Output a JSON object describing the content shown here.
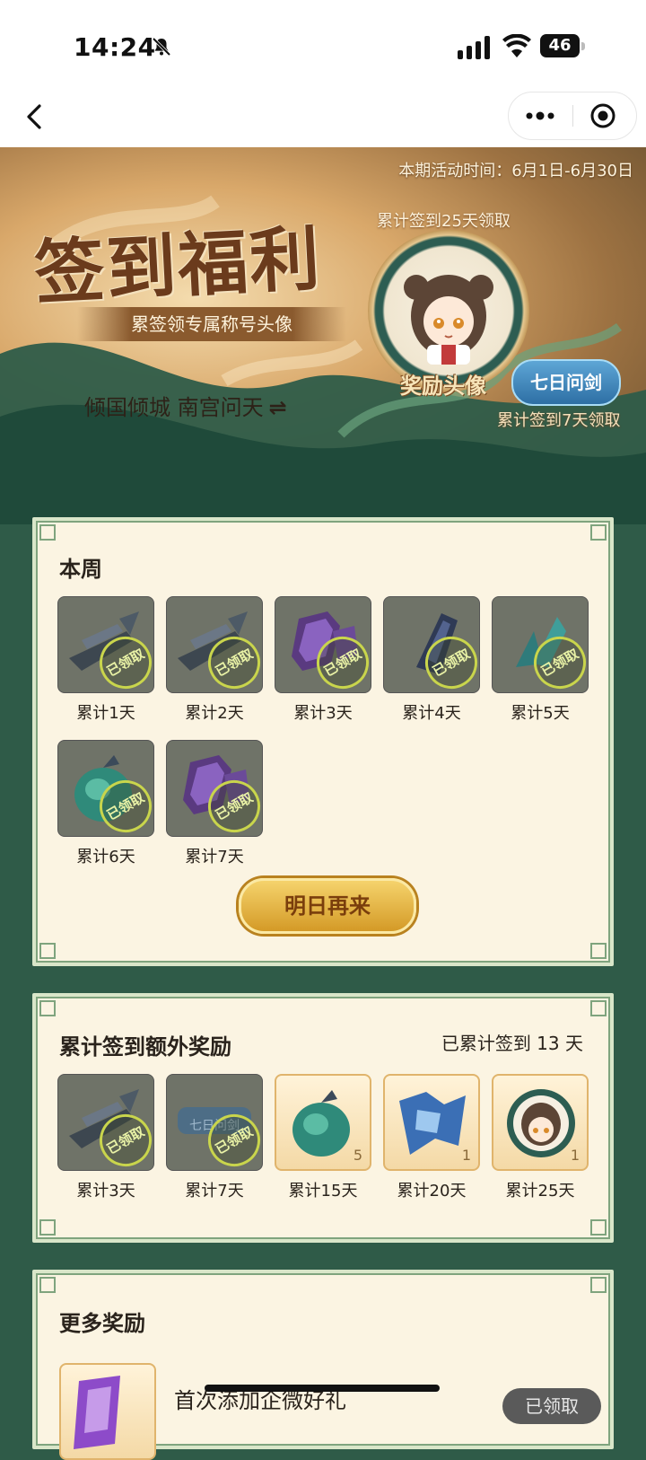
{
  "status": {
    "time": "14:24",
    "battery": "46"
  },
  "hero": {
    "period": "本期活动时间：6月1日-6月30日",
    "title": "签到福利",
    "subtitle": "累签领专属称号头像",
    "player": "倾国倾城 南宫问天",
    "swap_icon": "⇌",
    "avatar_requirement": "累计签到25天领取",
    "avatar_label": "奖励头像",
    "badge": "七日问剑",
    "badge_requirement": "累计签到7天领取"
  },
  "week": {
    "title": "本周",
    "claimed_text": "已领取",
    "items": [
      {
        "label": "累计1天",
        "icon": "broken-sword-icon"
      },
      {
        "label": "累计2天",
        "icon": "broken-sword-icon"
      },
      {
        "label": "累计3天",
        "icon": "purple-token-icon"
      },
      {
        "label": "累计4天",
        "icon": "blue-crystal-icon"
      },
      {
        "label": "累计5天",
        "icon": "teal-shard-icon"
      },
      {
        "label": "累计6天",
        "icon": "green-pouch-icon"
      },
      {
        "label": "累计7天",
        "icon": "purple-token-icon"
      }
    ],
    "button": "明日再来"
  },
  "cumulative": {
    "title": "累计签到额外奖励",
    "streak": "已累计签到 13 天",
    "claimed_text": "已领取",
    "badge_text": "七日问剑",
    "items": [
      {
        "label": "累计3天",
        "claimed": true,
        "icon": "broken-sword-icon"
      },
      {
        "label": "累计7天",
        "claimed": true,
        "icon": "title-badge-icon"
      },
      {
        "label": "累计15天",
        "claimed": false,
        "qty": "5",
        "icon": "green-pouch-icon"
      },
      {
        "label": "累计20天",
        "claimed": false,
        "qty": "1",
        "icon": "blue-robe-icon"
      },
      {
        "label": "累计25天",
        "claimed": false,
        "qty": "1",
        "icon": "avatar-frame-icon"
      }
    ]
  },
  "more": {
    "title": "更多奖励",
    "first_item": "首次添加企微好礼",
    "first_button": "已领取"
  },
  "colors": {
    "panel_bg": "#fbf4e2",
    "panel_border": "#7fa47e",
    "page_bg": "#2f5b48",
    "gold": "#d49a27"
  }
}
